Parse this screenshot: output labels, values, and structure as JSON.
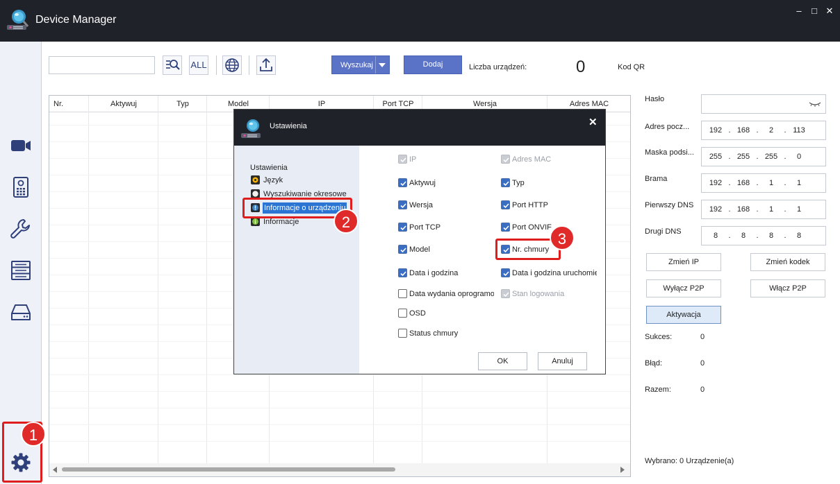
{
  "window": {
    "title": "Device Manager",
    "controls": {
      "minimize": "–",
      "maximize": "□",
      "close": "✕"
    },
    "accent": "#1f2229"
  },
  "sidebar": {
    "items": [
      "camera-icon",
      "intercom-icon",
      "wrench-icon",
      "nvr-icon",
      "storage-icon",
      "gear-icon"
    ]
  },
  "toolbar": {
    "search_value": "",
    "icons": [
      "search-ip-icon",
      "all-icon",
      "globe-icon",
      "upload-icon"
    ],
    "all_label": "ALL",
    "search_button": "Wyszukaj",
    "add_button": "Dodaj",
    "count_label": "Liczba urządzeń:",
    "count_value": "0",
    "qr_label": "Kod QR"
  },
  "table": {
    "columns": [
      "Nr.",
      "Aktywuj",
      "Typ",
      "Model",
      "IP",
      "Port TCP",
      "Wersja",
      "Adres MAC"
    ]
  },
  "right_panel": {
    "password_label": "Hasło",
    "fields": [
      {
        "label": "Adres pocz...",
        "value": [
          "192",
          "168",
          "2",
          "113"
        ]
      },
      {
        "label": "Maska podsi...",
        "value": [
          "255",
          "255",
          "255",
          "0"
        ]
      },
      {
        "label": "Brama",
        "value": [
          "192",
          "168",
          "1",
          "1"
        ]
      },
      {
        "label": "Pierwszy DNS",
        "value": [
          "192",
          "168",
          "1",
          "1"
        ]
      },
      {
        "label": "Drugi DNS",
        "value": [
          "8",
          "8",
          "8",
          "8"
        ]
      }
    ],
    "buttons": {
      "change_ip": "Zmień IP",
      "change_code": "Zmień kodek",
      "disable_p2p": "Wyłącz P2P",
      "enable_p2p": "Włącz P2P",
      "activation": "Aktywacja"
    },
    "stats": [
      {
        "label": "Sukces:",
        "value": "0"
      },
      {
        "label": "Błąd:",
        "value": "0"
      },
      {
        "label": "Razem:",
        "value": "0"
      }
    ],
    "selected_text": "Wybrano: 0 Urządzenie(a)"
  },
  "dialog": {
    "title": "Ustawienia",
    "close": "✕",
    "tree": {
      "root": "Ustawienia",
      "items": [
        "Język",
        "Wyszukiwanie okresowe",
        "Informacje o urządzeniu",
        "Informacje"
      ]
    },
    "checkboxes": [
      {
        "label": "IP",
        "state": "disabled"
      },
      {
        "label": "Adres MAC",
        "state": "disabled"
      },
      {
        "label": "Aktywuj",
        "state": "checked"
      },
      {
        "label": "Typ",
        "state": "checked"
      },
      {
        "label": "Wersja",
        "state": "checked"
      },
      {
        "label": "Port HTTP",
        "state": "checked"
      },
      {
        "label": "Port TCP",
        "state": "checked"
      },
      {
        "label": "Port ONVIF",
        "state": "checked"
      },
      {
        "label": "Model",
        "state": "checked"
      },
      {
        "label": "Nr. chmury",
        "state": "checked"
      },
      {
        "label": "Data i godzina",
        "state": "checked"
      },
      {
        "label": "Data i godzina uruchomien",
        "state": "checked"
      },
      {
        "label": "Data wydania oprogramow",
        "state": "unchecked"
      },
      {
        "label": "Stan logowania",
        "state": "disabled"
      },
      {
        "label": "OSD",
        "state": "unchecked"
      },
      {
        "label": "Status chmury",
        "state": "unchecked"
      }
    ],
    "ok": "OK",
    "cancel": "Anuluj"
  },
  "annotations": [
    "1",
    "2",
    "3"
  ],
  "colors": {
    "highlight": "#e01d1d",
    "button_blue": "#5b73c6",
    "sidebar_icon": "#2e3f7a",
    "selection": "#2a74d3"
  }
}
